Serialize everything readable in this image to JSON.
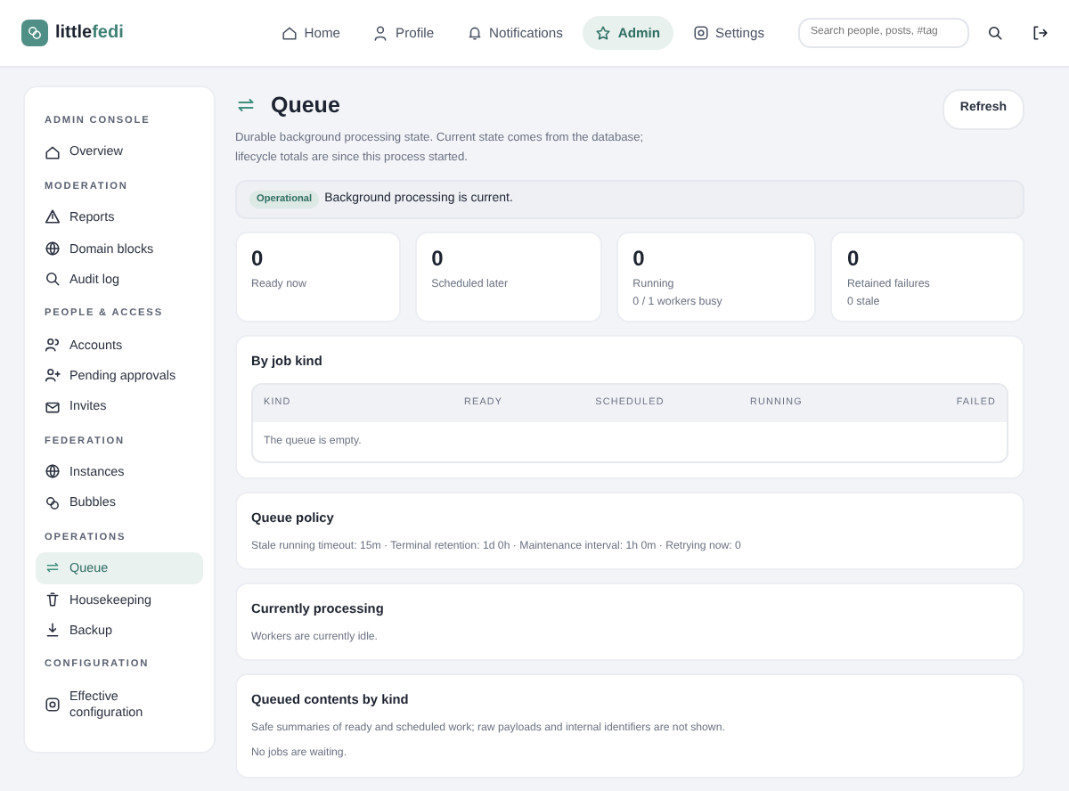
{
  "brand": {
    "name_start": "little",
    "name_end": "fedi"
  },
  "nav": [
    {
      "label": "Home",
      "selected": false
    },
    {
      "label": "Profile",
      "selected": false
    },
    {
      "label": "Notifications",
      "selected": false
    },
    {
      "label": "Admin",
      "selected": true
    },
    {
      "label": "Settings",
      "selected": false
    }
  ],
  "search": {
    "placeholder": "Search people, posts, #tag"
  },
  "sidebar": {
    "sections": [
      {
        "heading": "ADMIN CONSOLE",
        "items": [
          {
            "label": "Overview",
            "selected": false
          }
        ]
      },
      {
        "heading": "MODERATION",
        "items": [
          {
            "label": "Reports",
            "selected": false
          },
          {
            "label": "Domain blocks",
            "selected": false
          },
          {
            "label": "Audit log",
            "selected": false
          }
        ]
      },
      {
        "heading": "PEOPLE & ACCESS",
        "items": [
          {
            "label": "Accounts",
            "selected": false
          },
          {
            "label": "Pending approvals",
            "selected": false
          },
          {
            "label": "Invites",
            "selected": false
          }
        ]
      },
      {
        "heading": "FEDERATION",
        "items": [
          {
            "label": "Instances",
            "selected": false
          },
          {
            "label": "Bubbles",
            "selected": false
          }
        ]
      },
      {
        "heading": "OPERATIONS",
        "items": [
          {
            "label": "Queue",
            "selected": true
          },
          {
            "label": "Housekeeping",
            "selected": false
          },
          {
            "label": "Backup",
            "selected": false
          }
        ]
      },
      {
        "heading": "CONFIGURATION",
        "items": [
          {
            "label": "Effective configuration",
            "selected": false
          }
        ]
      }
    ]
  },
  "page": {
    "title": "Queue",
    "description": "Durable background processing state. Current state comes from the database; lifecycle totals are since this process started.",
    "refresh_button": "Refresh"
  },
  "status": {
    "badge": "Operational",
    "message": "Background processing is current."
  },
  "stats": [
    {
      "value": "0",
      "label": "Ready now"
    },
    {
      "value": "0",
      "label": "Scheduled later"
    },
    {
      "value": "0",
      "label": "Running",
      "detail": "0 / 1 workers busy"
    },
    {
      "value": "0",
      "label": "Retained failures",
      "detail": "0 stale"
    }
  ],
  "by_job_kind": {
    "title": "By job kind",
    "columns": [
      "KIND",
      "READY",
      "SCHEDULED",
      "RUNNING",
      "FAILED"
    ],
    "empty": "The queue is empty."
  },
  "sections": [
    {
      "title": "Queue policy",
      "lines": [
        "Stale running timeout: 15m · Terminal retention: 1d 0h · Maintenance interval: 1h 0m · Retrying now: 0"
      ]
    },
    {
      "title": "Currently processing",
      "lines": [
        "Workers are currently idle."
      ]
    },
    {
      "title": "Queued contents by kind",
      "lines": [
        "Safe summaries of ready and scheduled work; raw payloads and internal identifiers are not shown.",
        "No jobs are waiting."
      ]
    }
  ]
}
